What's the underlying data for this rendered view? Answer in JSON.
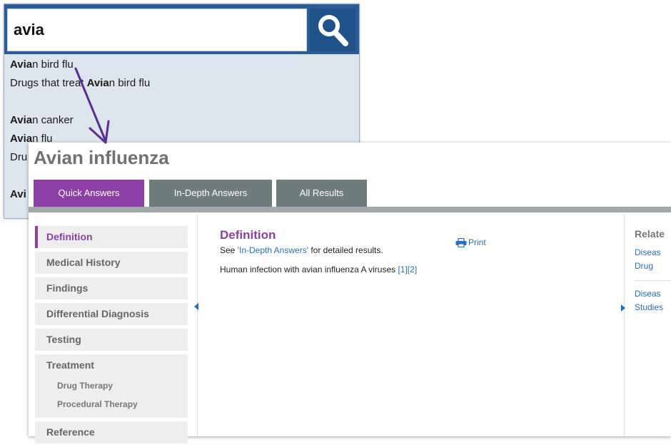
{
  "search": {
    "query": "avia",
    "suggestions": [
      {
        "match": "Avia",
        "rest": "n bird flu"
      },
      {
        "prefix": "Drugs that treat ",
        "match": "Avia",
        "rest": "n bird flu"
      },
      {
        "match": "Avia",
        "rest": "n canker"
      },
      {
        "match": "Avia",
        "rest": "n flu"
      },
      {
        "prefix": "Dru",
        "match": "",
        "rest": ""
      },
      {
        "match": "Avi",
        "rest": ""
      }
    ]
  },
  "topic": {
    "title": "Avian influenza",
    "tabs": [
      "Quick Answers",
      "In-Depth Answers",
      "All Results"
    ],
    "nav": {
      "definition": "Definition",
      "medical_history": "Medical History",
      "findings": "Findings",
      "differential_diagnosis": "Differential Diagnosis",
      "testing": "Testing",
      "treatment": "Treatment",
      "drug_therapy": "Drug Therapy",
      "procedural_therapy": "Procedural Therapy",
      "reference": "Reference"
    },
    "content": {
      "heading": "Definition",
      "see_prefix": "See ",
      "see_link": "'In-Depth Answers'",
      "see_suffix": " for detailed results.",
      "definition_text": "Human infection with avian influenza A viruses ",
      "citations": "[1][2]",
      "print_label": "Print"
    },
    "related": {
      "heading": "Relate",
      "link1_line1": "Diseas",
      "link1_line2": "Drug",
      "link2_line1": "Diseas",
      "link2_line2": "Studies"
    }
  },
  "colors": {
    "accent_purple": "#8c3fa6",
    "tab_gray": "#6f7c7c",
    "search_blue": "#2a5d95",
    "link_blue": "#2a6ebd",
    "arrow_purple": "#5a2d91"
  }
}
